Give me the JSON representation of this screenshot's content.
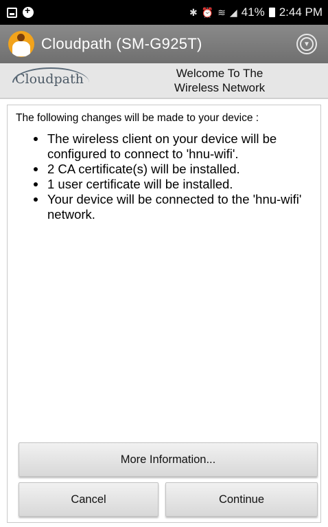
{
  "status_bar": {
    "battery": "41%",
    "time": "2:44 PM",
    "left_icons": [
      "gallery-icon",
      "notification-icon"
    ],
    "right_icons": [
      "bluetooth-icon",
      "alarm-icon",
      "wifi-icon",
      "signal-icon",
      "battery-icon"
    ]
  },
  "app_bar": {
    "title": "Cloudpath  (SM-G925T)",
    "logo_icon": "cloudpath-person-icon",
    "menu_icon": "chevron-down-circle-icon"
  },
  "banner": {
    "logo_text": "Cloudpath",
    "welcome_line1": "Welcome To The",
    "welcome_line2": "Wireless Network"
  },
  "main": {
    "intro": "The following changes will be made to your device :",
    "changes": [
      "The wireless client on your device will be configured to connect to 'hnu-wifi'.",
      "2 CA certificate(s) will be installed.",
      "1 user certificate will be installed.",
      "Your device will be connected to the 'hnu-wifi' network."
    ]
  },
  "buttons": {
    "more_info": "More Information...",
    "cancel": "Cancel",
    "continue": "Continue"
  },
  "colors": {
    "app_bar": "#7c7c7c",
    "banner": "#e6e6e6",
    "logo_accent": "#f2a31b"
  }
}
